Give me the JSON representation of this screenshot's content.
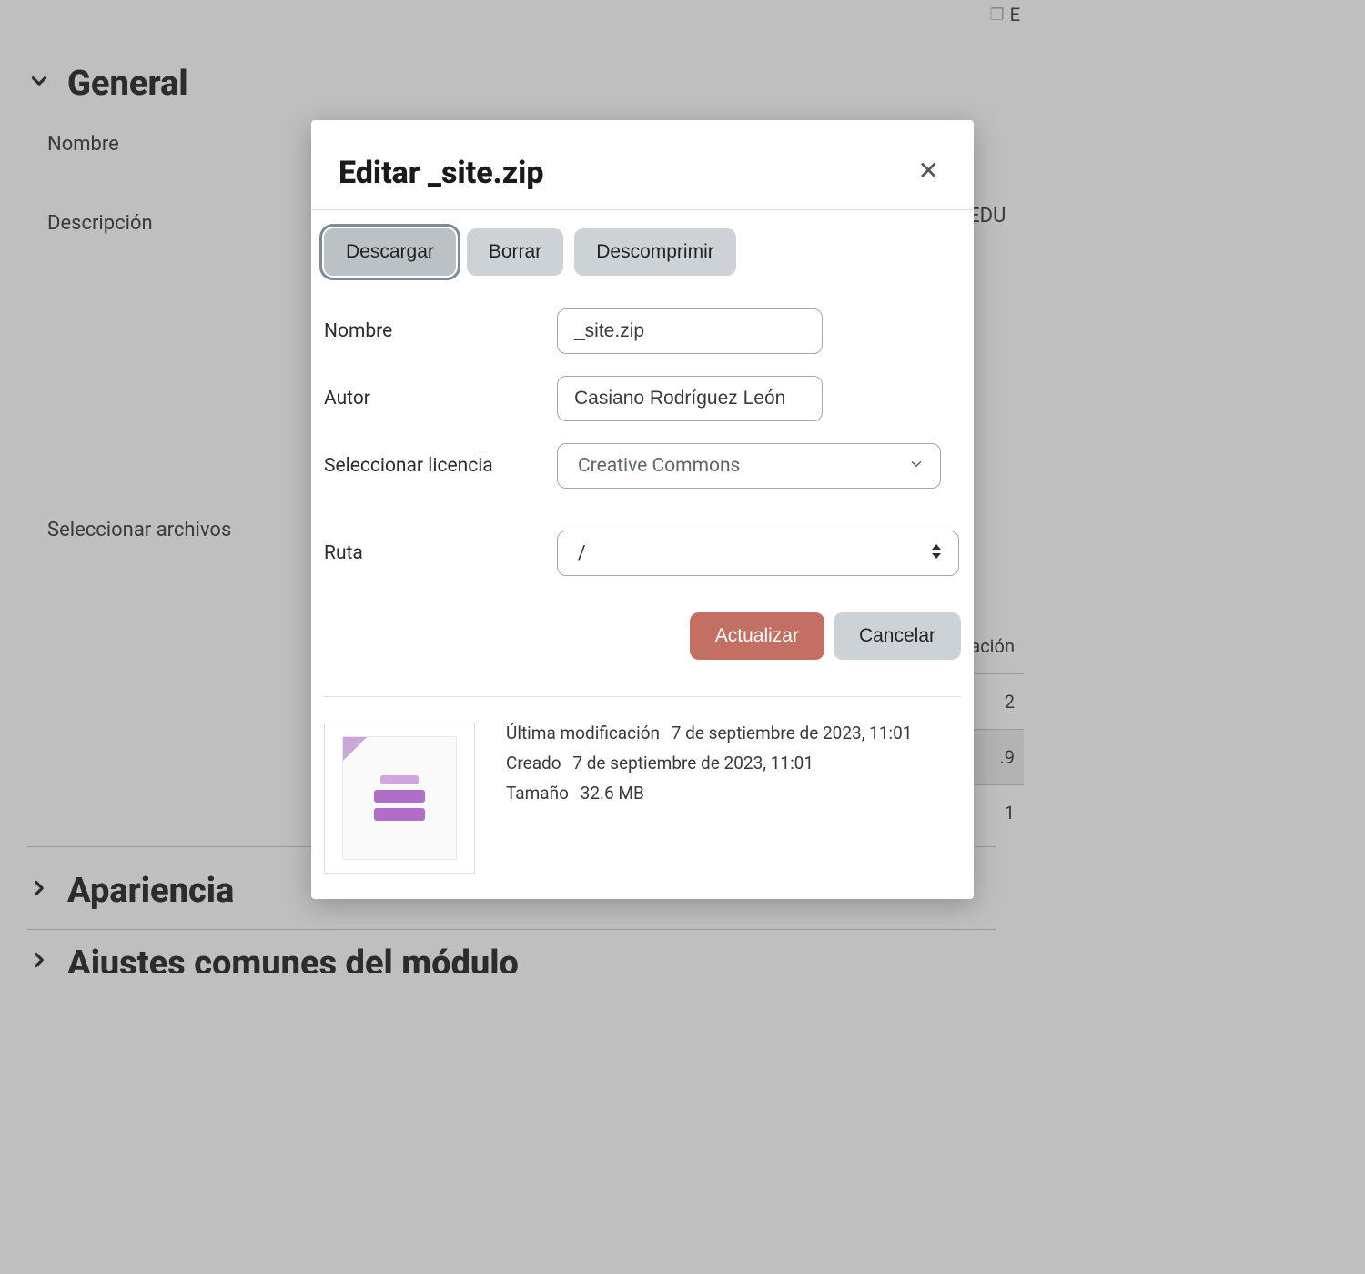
{
  "topRight": {
    "label": "E"
  },
  "sections": {
    "general": {
      "title": "General",
      "expanded": true
    },
    "appearance": {
      "title": "Apariencia",
      "expanded": false
    },
    "common": {
      "title": "Ajustes comunes del módulo",
      "expanded": false
    }
  },
  "bgForm": {
    "name_label": "Nombre",
    "description_label": "Descripción",
    "select_files_label": "Seleccionar archivos"
  },
  "bgRight": {
    "edu": "B EDU",
    "acion": "ación",
    "rows": [
      "2",
      ".9",
      "1"
    ]
  },
  "modal": {
    "title": "Editar _site.zip",
    "actions": {
      "download": "Descargar",
      "delete": "Borrar",
      "unzip": "Descomprimir"
    },
    "fields": {
      "name_label": "Nombre",
      "name_value": "_site.zip",
      "author_label": "Autor",
      "author_value": "Casiano Rodríguez León",
      "license_label": "Seleccionar licencia",
      "license_value": "Creative Commons",
      "path_label": "Ruta",
      "path_value": "/"
    },
    "footer": {
      "update": "Actualizar",
      "cancel": "Cancelar"
    },
    "meta": {
      "modified_label": "Última modificación",
      "modified_value": "7 de septiembre de 2023, 11:01",
      "created_label": "Creado",
      "created_value": "7 de septiembre de 2023, 11:01",
      "size_label": "Tamaño",
      "size_value": "32.6 MB"
    }
  }
}
